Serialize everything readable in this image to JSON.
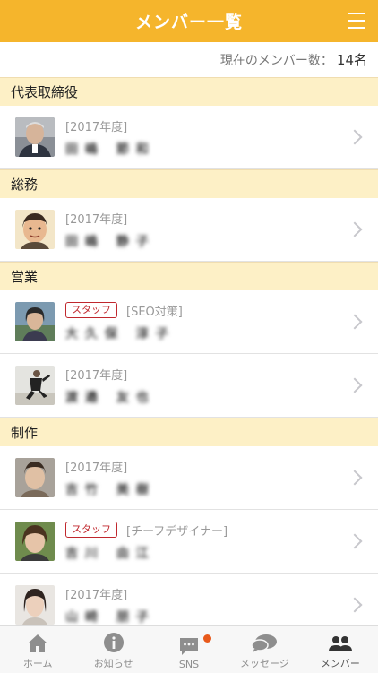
{
  "header": {
    "title": "メンバー一覧"
  },
  "count": {
    "label": "現在のメンバー数：",
    "value": "14名"
  },
  "sections": [
    {
      "title": "代表取締役"
    },
    {
      "title": "総務"
    },
    {
      "title": "営業"
    },
    {
      "title": "制作"
    }
  ],
  "members": [
    {
      "year": "[2017年度]",
      "name": "田嶋 節和"
    },
    {
      "year": "[2017年度]",
      "name": "田嶋 静子"
    },
    {
      "tag": "スタッフ",
      "dept": "[SEO対策]",
      "name": "大久保 淳子"
    },
    {
      "year": "[2017年度]",
      "name": "渡邉 友也"
    },
    {
      "year": "[2017年度]",
      "name": "吉竹 美樹"
    },
    {
      "tag": "スタッフ",
      "dept": "[チーフデザイナー]",
      "name": "吉川 由江"
    },
    {
      "year": "[2017年度]",
      "name": "山崎 朋子"
    }
  ],
  "tabs": [
    {
      "label": "ホーム",
      "icon": "home-icon"
    },
    {
      "label": "お知らせ",
      "icon": "info-icon"
    },
    {
      "label": "SNS",
      "icon": "sns-icon"
    },
    {
      "label": "メッセージ",
      "icon": "message-icon"
    },
    {
      "label": "メンバー",
      "icon": "members-icon"
    }
  ],
  "colors": {
    "accent": "#f5b52c",
    "section_bg": "#fdf0c6",
    "tag": "#c0272d",
    "badge": "#e8591b"
  }
}
